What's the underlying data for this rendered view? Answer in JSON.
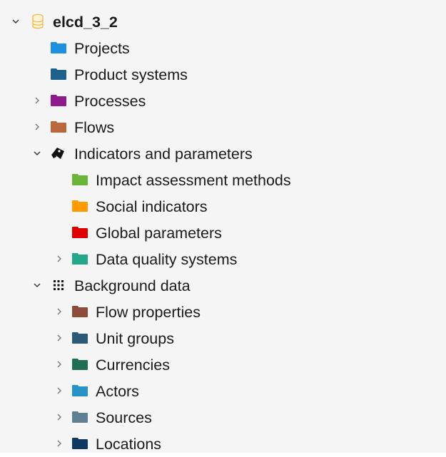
{
  "tree": {
    "root": {
      "label": "elcd_3_2",
      "icon": "database-icon",
      "color": "#f0b94c"
    },
    "projects": {
      "label": "Projects",
      "icon": "folder-icon",
      "color": "#1e90e0"
    },
    "product_systems": {
      "label": "Product systems",
      "icon": "folder-icon",
      "color": "#1f5f8b"
    },
    "processes": {
      "label": "Processes",
      "icon": "folder-icon",
      "color": "#8e1a8e"
    },
    "flows": {
      "label": "Flows",
      "icon": "folder-icon",
      "color": "#b8693d"
    },
    "indicators": {
      "label": "Indicators and parameters",
      "icon": "tag-icon",
      "color": "#111111"
    },
    "impact_methods": {
      "label": "Impact assessment methods",
      "icon": "folder-icon",
      "color": "#6ab43b"
    },
    "social_indicators": {
      "label": "Social indicators",
      "icon": "folder-icon",
      "color": "#ff9a00"
    },
    "global_parameters": {
      "label": "Global parameters",
      "icon": "folder-icon",
      "color": "#e00000"
    },
    "data_quality": {
      "label": "Data quality systems",
      "icon": "folder-icon",
      "color": "#25a88a"
    },
    "background": {
      "label": "Background data",
      "icon": "grid-icon",
      "color": "#111111"
    },
    "flow_properties": {
      "label": "Flow properties",
      "icon": "folder-icon",
      "color": "#8e4b3c"
    },
    "unit_groups": {
      "label": "Unit groups",
      "icon": "folder-icon",
      "color": "#2a5a78"
    },
    "currencies": {
      "label": "Currencies",
      "icon": "folder-icon",
      "color": "#1f6e55"
    },
    "actors": {
      "label": "Actors",
      "icon": "folder-icon",
      "color": "#2593c7"
    },
    "sources": {
      "label": "Sources",
      "icon": "folder-icon",
      "color": "#5f7f92"
    },
    "locations": {
      "label": "Locations",
      "icon": "folder-icon",
      "color": "#0f3a5f"
    }
  }
}
